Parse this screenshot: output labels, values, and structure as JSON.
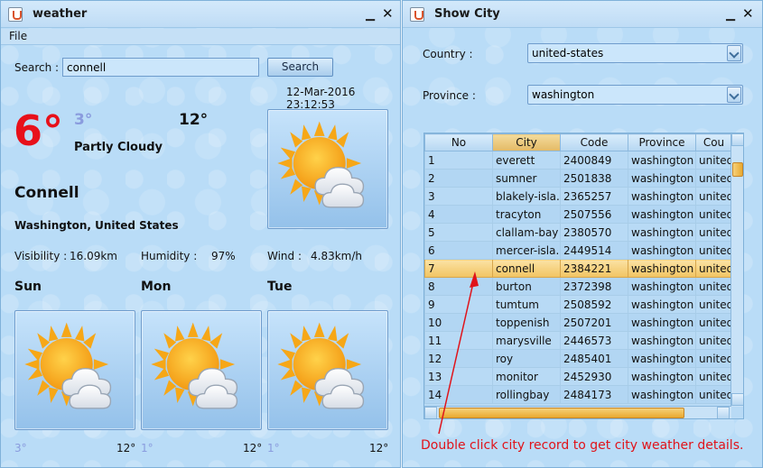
{
  "weather_window": {
    "title": "weather",
    "min_glyph": "▁",
    "close_glyph": "✕",
    "menu": {
      "file": "File"
    },
    "search": {
      "label": "Search :",
      "value": "connell",
      "button": "Search"
    },
    "datetime": "12-Mar-2016 23:12:53",
    "current": {
      "temp": "6°",
      "low": "3°",
      "high": "12°",
      "condition": "Partly Cloudy",
      "icon": "partly-cloudy-icon",
      "city": "Connell",
      "region": "Washington, United States",
      "visibility_label": "Visibility :",
      "visibility_value": "16.09km",
      "humidity_label": "Humidity :",
      "humidity_value": "97%",
      "wind_label": "Wind :",
      "wind_value": "4.83km/h"
    },
    "forecast": [
      {
        "day": "Sun",
        "low": "3°",
        "high": "12°",
        "icon": "partly-cloudy-icon"
      },
      {
        "day": "Mon",
        "low": "1°",
        "high": "12°",
        "icon": "partly-cloudy-icon"
      },
      {
        "day": "Tue",
        "low": "1°",
        "high": "12°",
        "icon": "partly-cloudy-icon"
      }
    ]
  },
  "city_window": {
    "title": "Show City",
    "min_glyph": "▁",
    "close_glyph": "✕",
    "country_label": "Country :",
    "country_value": "united-states",
    "province_label": "Province :",
    "province_value": "washington",
    "table": {
      "columns": [
        "No",
        "City",
        "Code",
        "Province",
        "Cou"
      ],
      "rows": [
        [
          "1",
          "everett",
          "2400849",
          "washington",
          "united"
        ],
        [
          "2",
          "sumner",
          "2501838",
          "washington",
          "united"
        ],
        [
          "3",
          "blakely-isla...",
          "2365257",
          "washington",
          "united"
        ],
        [
          "4",
          "tracyton",
          "2507556",
          "washington",
          "united"
        ],
        [
          "5",
          "clallam-bay",
          "2380570",
          "washington",
          "united"
        ],
        [
          "6",
          "mercer-isla...",
          "2449514",
          "washington",
          "united"
        ],
        [
          "7",
          "connell",
          "2384221",
          "washington",
          "united"
        ],
        [
          "8",
          "burton",
          "2372398",
          "washington",
          "united"
        ],
        [
          "9",
          "tumtum",
          "2508592",
          "washington",
          "united"
        ],
        [
          "10",
          "toppenish",
          "2507201",
          "washington",
          "united"
        ],
        [
          "11",
          "marysville",
          "2446573",
          "washington",
          "united"
        ],
        [
          "12",
          "roy",
          "2485401",
          "washington",
          "united"
        ],
        [
          "13",
          "monitor",
          "2452930",
          "washington",
          "united"
        ],
        [
          "14",
          "rollingbay",
          "2484173",
          "washington",
          "united"
        ]
      ],
      "selected_row": 7
    },
    "annotation": "Double click city record to get city weather details.",
    "annotation_color": "#e0131a"
  }
}
